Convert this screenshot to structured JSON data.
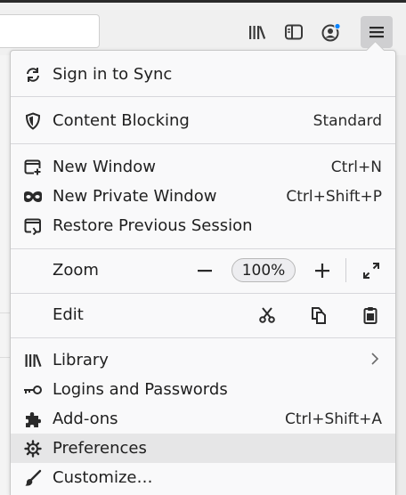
{
  "toolbar": {
    "icons": [
      "library-icon",
      "sidebar-icon",
      "account-icon",
      "hamburger-menu-icon"
    ]
  },
  "menu": {
    "sync": {
      "label": "Sign in to Sync",
      "icon": "sync-icon"
    },
    "content_blocking": {
      "label": "Content Blocking",
      "value": "Standard",
      "icon": "shield-icon"
    },
    "new_window": {
      "label": "New Window",
      "accel": "Ctrl+N",
      "icon": "new-window-icon"
    },
    "new_private_window": {
      "label": "New Private Window",
      "accel": "Ctrl+Shift+P",
      "icon": "mask-icon"
    },
    "restore_session": {
      "label": "Restore Previous Session",
      "icon": "restore-icon"
    },
    "zoom": {
      "label": "Zoom",
      "level": "100%"
    },
    "edit": {
      "label": "Edit"
    },
    "library": {
      "label": "Library",
      "icon": "library-icon"
    },
    "logins": {
      "label": "Logins and Passwords",
      "icon": "key-icon"
    },
    "addons": {
      "label": "Add-ons",
      "accel": "Ctrl+Shift+A",
      "icon": "puzzle-icon"
    },
    "preferences": {
      "label": "Preferences",
      "icon": "gear-icon"
    },
    "customize": {
      "label": "Customize…",
      "icon": "paintbrush-icon"
    }
  },
  "colors": {
    "accent_dot": "#0a84ff",
    "hover_bg": "#e6e6e7",
    "menu_bg": "#f9f9fa"
  }
}
